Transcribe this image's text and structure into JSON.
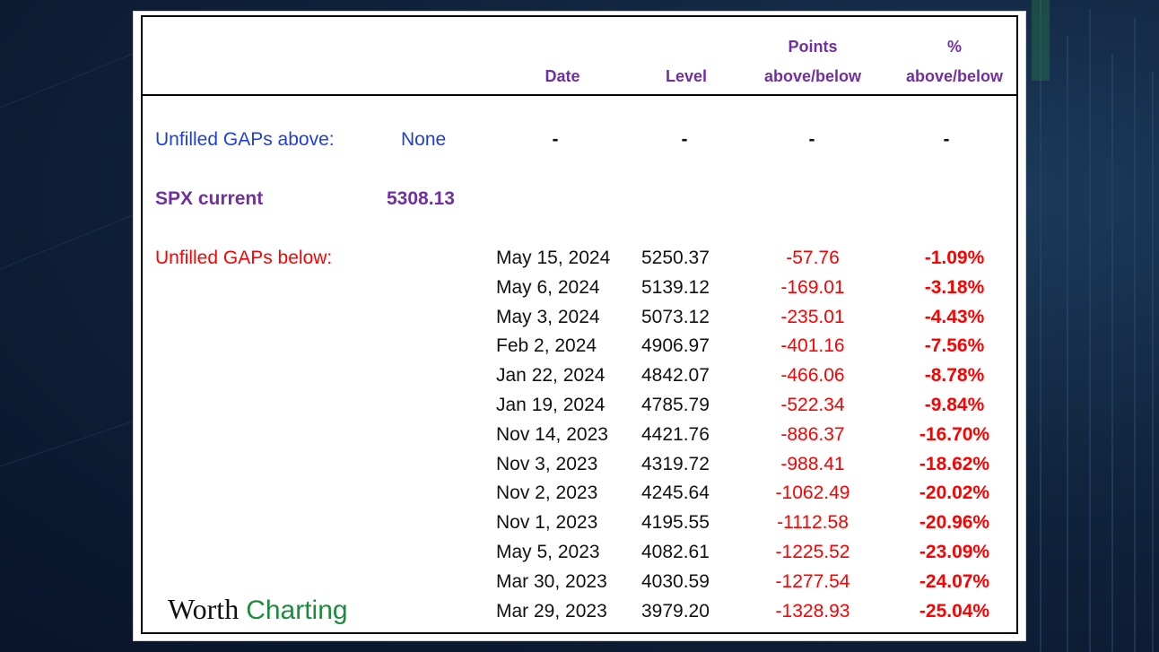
{
  "header": {
    "date": "Date",
    "level": "Level",
    "points_line1": "Points",
    "points_line2": "above/below",
    "pct_line1": "%",
    "pct_line2": "above/below"
  },
  "gaps_above": {
    "label": "Unfilled GAPs above:",
    "value": "None",
    "date": "-",
    "level": "-",
    "points": "-",
    "pct": "-"
  },
  "spx": {
    "label": "SPX current",
    "value": "5308.13"
  },
  "gaps_below": {
    "label": "Unfilled GAPs below:",
    "rows": [
      {
        "date": "May 15, 2024",
        "level": "5250.37",
        "points": "-57.76",
        "pct": "-1.09%"
      },
      {
        "date": "May 6, 2024",
        "level": "5139.12",
        "points": "-169.01",
        "pct": "-3.18%"
      },
      {
        "date": "May 3, 2024",
        "level": "5073.12",
        "points": "-235.01",
        "pct": "-4.43%"
      },
      {
        "date": "Feb 2, 2024",
        "level": "4906.97",
        "points": "-401.16",
        "pct": "-7.56%"
      },
      {
        "date": "Jan 22, 2024",
        "level": "4842.07",
        "points": "-466.06",
        "pct": "-8.78%"
      },
      {
        "date": "Jan 19, 2024",
        "level": "4785.79",
        "points": "-522.34",
        "pct": "-9.84%"
      },
      {
        "date": "Nov 14, 2023",
        "level": "4421.76",
        "points": "-886.37",
        "pct": "-16.70%"
      },
      {
        "date": "Nov 3, 2023",
        "level": "4319.72",
        "points": "-988.41",
        "pct": "-18.62%"
      },
      {
        "date": "Nov 2, 2023",
        "level": "4245.64",
        "points": "-1062.49",
        "pct": "-20.02%"
      },
      {
        "date": "Nov 1, 2023",
        "level": "4195.55",
        "points": "-1112.58",
        "pct": "-20.96%"
      },
      {
        "date": "May 5, 2023",
        "level": "4082.61",
        "points": "-1225.52",
        "pct": "-23.09%"
      },
      {
        "date": "Mar 30, 2023",
        "level": "4030.59",
        "points": "-1277.54",
        "pct": "-24.07%"
      },
      {
        "date": "Mar 29, 2023",
        "level": "3979.20",
        "points": "-1328.93",
        "pct": "-25.04%"
      }
    ]
  },
  "logo": {
    "word1": "Worth",
    "word2": "Charting"
  },
  "colors": {
    "header": "#7030a0",
    "above": "#1f3fd6",
    "below": "#ff0000",
    "logo_green": "#1e8a3c"
  }
}
